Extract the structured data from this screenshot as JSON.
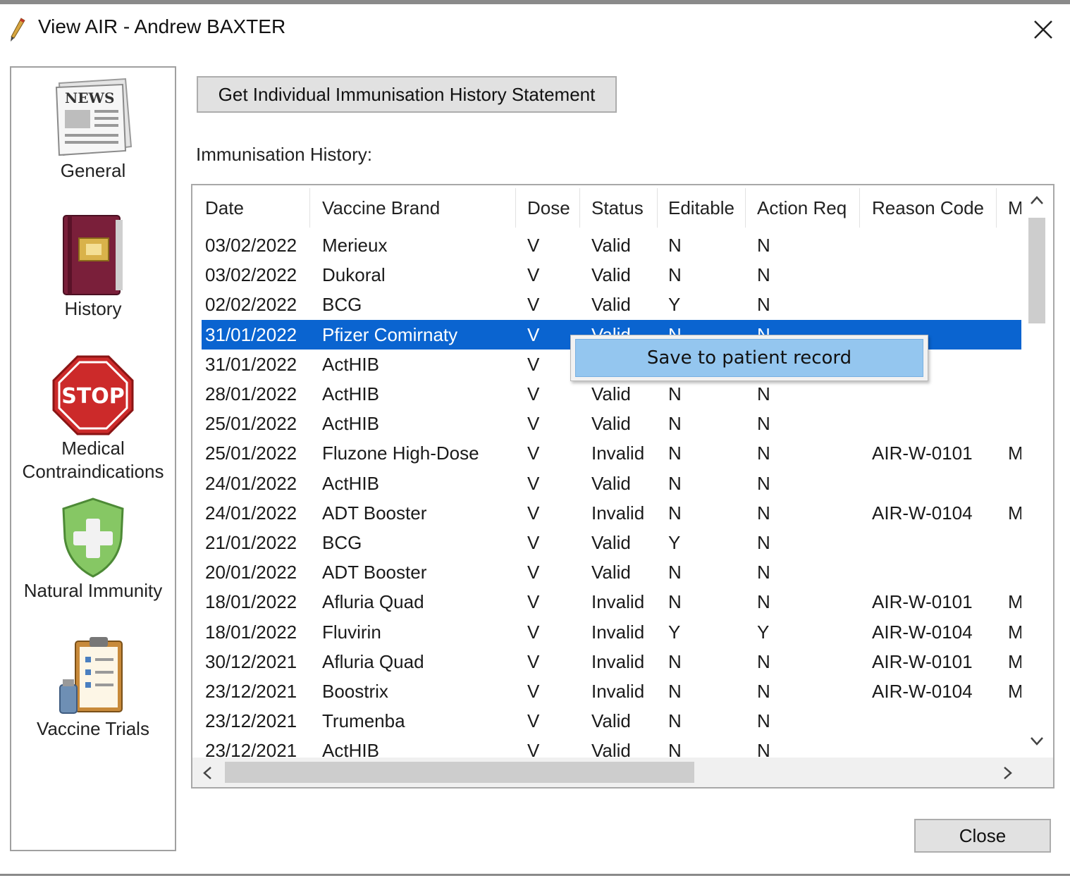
{
  "window": {
    "title": "View AIR - Andrew BAXTER",
    "icon": "pen-icon",
    "close_icon": "close-icon"
  },
  "sidebar": {
    "items": [
      {
        "label_lines": [
          "General"
        ],
        "icon": "newspaper-icon"
      },
      {
        "label_lines": [
          "History"
        ],
        "icon": "history-book-icon"
      },
      {
        "label_lines": [
          "Medical",
          "Contraindications"
        ],
        "icon": "stop-sign-icon"
      },
      {
        "label_lines": [
          "Natural Immunity"
        ],
        "icon": "shield-plus-icon"
      },
      {
        "label_lines": [
          "Vaccine Trials"
        ],
        "icon": "clipboard-icon"
      }
    ]
  },
  "main": {
    "statement_button": "Get Individual Immunisation History Statement",
    "history_label": "Immunisation History:",
    "close_button": "Close"
  },
  "table": {
    "columns": [
      "Date",
      "Vaccine Brand",
      "Dose",
      "Status",
      "Editable",
      "Action Req",
      "Reason Code",
      "M"
    ],
    "rows": [
      [
        "03/02/2022",
        "Merieux",
        "V",
        "Valid",
        "N",
        "N",
        "",
        ""
      ],
      [
        "03/02/2022",
        "Dukoral",
        "V",
        "Valid",
        "N",
        "N",
        "",
        ""
      ],
      [
        "02/02/2022",
        "BCG",
        "V",
        "Valid",
        "Y",
        "N",
        "",
        ""
      ],
      [
        "31/01/2022",
        "Pfizer Comirnaty",
        "V",
        "Valid",
        "N",
        "N",
        "",
        ""
      ],
      [
        "31/01/2022",
        "ActHIB",
        "V",
        "",
        "",
        "",
        "",
        ""
      ],
      [
        "28/01/2022",
        "ActHIB",
        "V",
        "Valid",
        "N",
        "N",
        "",
        ""
      ],
      [
        "25/01/2022",
        "ActHIB",
        "V",
        "Valid",
        "N",
        "N",
        "",
        ""
      ],
      [
        "25/01/2022",
        "Fluzone High-Dose",
        "V",
        "Invalid",
        "N",
        "N",
        "AIR-W-0101",
        "M"
      ],
      [
        "24/01/2022",
        "ActHIB",
        "V",
        "Valid",
        "N",
        "N",
        "",
        ""
      ],
      [
        "24/01/2022",
        "ADT Booster",
        "V",
        "Invalid",
        "N",
        "N",
        "AIR-W-0104",
        "M"
      ],
      [
        "21/01/2022",
        "BCG",
        "V",
        "Valid",
        "Y",
        "N",
        "",
        ""
      ],
      [
        "20/01/2022",
        "ADT Booster",
        "V",
        "Valid",
        "N",
        "N",
        "",
        ""
      ],
      [
        "18/01/2022",
        "Afluria Quad",
        "V",
        "Invalid",
        "N",
        "N",
        "AIR-W-0101",
        "M"
      ],
      [
        "18/01/2022",
        "Fluvirin",
        "V",
        "Invalid",
        "Y",
        "Y",
        "AIR-W-0104",
        "M"
      ],
      [
        "30/12/2021",
        "Afluria Quad",
        "V",
        "Invalid",
        "N",
        "N",
        "AIR-W-0101",
        "M"
      ],
      [
        "23/12/2021",
        "Boostrix",
        "V",
        "Invalid",
        "N",
        "N",
        "AIR-W-0104",
        "M"
      ],
      [
        "23/12/2021",
        "Trumenba",
        "V",
        "Valid",
        "N",
        "N",
        "",
        ""
      ],
      [
        "23/12/2021",
        "ActHIB",
        "V",
        "Valid",
        "N",
        "N",
        "",
        ""
      ]
    ],
    "selected_row": 3
  },
  "context_menu": {
    "items": [
      "Save to patient record"
    ]
  },
  "scrollbars": {
    "up_icon": "scroll-up-icon",
    "down_icon": "scroll-down-icon",
    "left_icon": "scroll-left-icon",
    "right_icon": "scroll-right-icon"
  },
  "colors": {
    "selection": "#0a64d0",
    "context_highlight": "#94c6ef",
    "button_face": "#e1e1e1"
  }
}
